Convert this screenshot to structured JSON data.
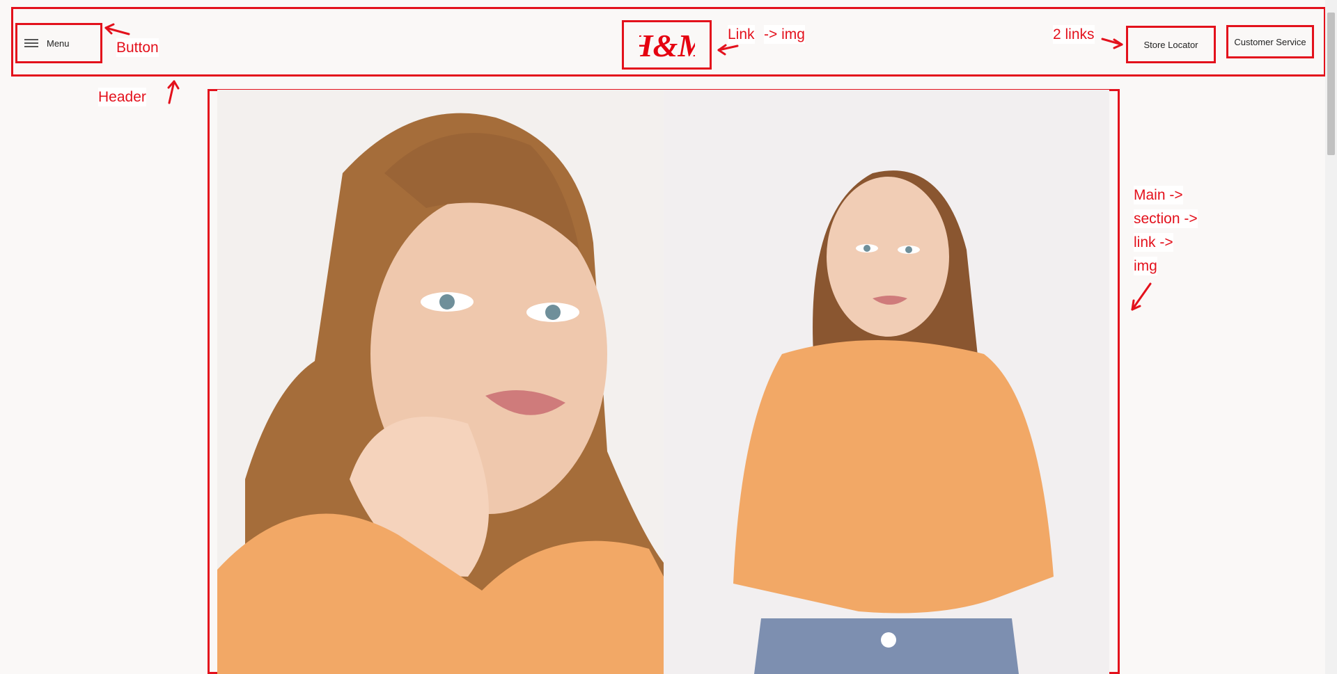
{
  "header": {
    "menu_label": "Menu",
    "logo_text": "H&M",
    "links": [
      "Store Locator",
      "Customer Service"
    ]
  },
  "annotations": {
    "button": "Button",
    "header": "Header",
    "link_img_1": "Link",
    "link_img_2": "-> img",
    "two_links": "2 links",
    "main_1": "Main ->",
    "main_2": "section ->",
    "main_3": "link ->",
    "main_4": "img"
  },
  "colors": {
    "annotation_red": "#e3111c",
    "brand_red": "#e50010",
    "page_background": "#faf8f7",
    "sweater_orange": "#f2a866"
  },
  "carousel": {
    "active_index": 0
  }
}
